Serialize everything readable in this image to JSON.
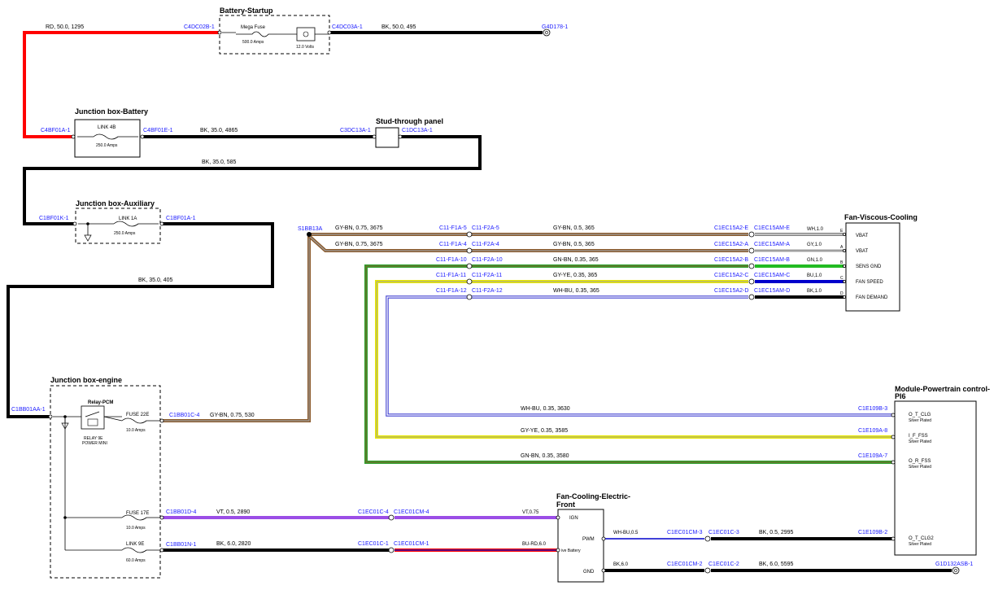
{
  "components": {
    "battery_startup": {
      "title": "Battery-Startup",
      "fuse_label": "Mega Fuse",
      "fuse_rating": "500.0 Amps",
      "battery_voltage": "12.0 Volts"
    },
    "jb_battery": {
      "title": "Junction box-Battery",
      "link": "LINK 4B",
      "rating": "250.0 Amps"
    },
    "stud_panel": {
      "title": "Stud-through panel"
    },
    "jb_aux": {
      "title": "Junction box-Auxiliary",
      "link": "LINK 1A",
      "rating": "250.0 Amps"
    },
    "jb_engine": {
      "title": "Junction box-engine",
      "relay": "Relay-PCM",
      "relay_sub1": "RELAY 9E",
      "relay_sub2": "POWER MINI",
      "fuse22e": "FUSE 22E",
      "fuse22e_rating": "10.0 Amps",
      "fuse17e": "FUSE 17E",
      "fuse17e_rating": "10.0 Amps",
      "link9e": "LINK 9E",
      "link9e_rating": "60.0 Amps"
    },
    "fan_viscous": {
      "title": "Fan-Viscous-Cooling",
      "pins": [
        "VBAT",
        "VBAT",
        "SENS GND",
        "FAN SPEED",
        "FAN DEMAND"
      ]
    },
    "pcm": {
      "title1": "Module-Powertrain control-",
      "title2": "PI6",
      "pins": [
        "O_T_CLG",
        "I_F_FSS",
        "O_R_FSS",
        "O_T_CLG2"
      ],
      "plated": "Silver Plated"
    },
    "fan_front": {
      "title1": "Fan-Cooling-Electric-",
      "title2": "Front",
      "pins": [
        "IGN",
        "PWM",
        "ive Battery",
        "GND"
      ]
    }
  },
  "connectors": {
    "c4dc02b": "C4DC02B-1",
    "c4dc03a": "C4DC03A-1",
    "g4d178": "G4D178-1",
    "c4bf01a": "C4BF01A-1",
    "c4bf01e": "C4BF01E-1",
    "c3dc13a": "C3DC13A-1",
    "c1dc13a": "C1DC13A-1",
    "c1bf01k": "C1BF01K-1",
    "c1bf01a": "C1BF01A-1",
    "c1bb01aa": "C1BB01AA-1",
    "s1bb13a": "S1BB13A",
    "c1bb01c": "C1BB01C-4",
    "c1bb01d": "C1BB01D-4",
    "c1bb01n": "C1BB01N-1",
    "c11f1a5": "C11-F1A-5",
    "c11f2a5": "C11-F2A-5",
    "c11f1a4": "C11-F1A-4",
    "c11f2a4": "C11-F2A-4",
    "c11f1a10": "C11-F1A-10",
    "c11f2a10": "C11-F2A-10",
    "c11f1a11": "C11-F1A-11",
    "c11f2a11": "C11-F2A-11",
    "c11f1a12": "C11-F1A-12",
    "c11f2a12": "C11-F2A-12",
    "c1ec15a2e": "C1EC15A2-E",
    "c1ec15ame": "C1EC15AM-E",
    "c1ec15a2a": "C1EC15A2-A",
    "c1ec15ama": "C1EC15AM-A",
    "c1ec15a2b": "C1EC15A2-B",
    "c1ec15amb": "C1EC15AM-B",
    "c1ec15a2c": "C1EC15A2-C",
    "c1ec15amc": "C1EC15AM-C",
    "c1ec15a2d": "C1EC15A2-D",
    "c1ec15amd": "C1EC15AM-D",
    "c1e109b3": "C1E109B-3",
    "c1e109a8": "C1E109A-8",
    "c1e109a7": "C1E109A-7",
    "c1e109b2": "C1E109B-2",
    "c1ec01c4": "C1EC01C-4",
    "c1ec01cm4": "C1EC01CM-4",
    "c1ec01c1": "C1EC01C-1",
    "c1ec01cm1": "C1EC01CM-1",
    "c1ec01cm3": "C1EC01CM-3",
    "c1ec01c3": "C1EC01C-3",
    "c1ec01cm2": "C1EC01CM-2",
    "c1ec01c2": "C1EC01C-2",
    "g1d132": "G1D132ASB-1"
  },
  "wires": {
    "w_rd": "RD, 50.0, 1295",
    "w_bk495": "BK, 50.0, 495",
    "w_bk4865": "BK, 35.0, 4865",
    "w_bk585": "BK, 35.0, 585",
    "w_bk405": "BK, 35.0, 405",
    "w_gybn530": "GY-BN, 0.75, 530",
    "w_gybn3675a": "GY-BN, 0.75, 3675",
    "w_gybn3675b": "GY-BN, 0.75, 3675",
    "w_gybn365a": "GY-BN, 0.5, 365",
    "w_gybn365b": "GY-BN, 0.5, 365",
    "w_gnbn365": "GN-BN, 0.35, 365",
    "w_gyye365": "GY-YE, 0.35, 365",
    "w_whbu365": "WH-BU, 0.35, 365",
    "w_fv1": "WH,1.0",
    "w_fv2": "GY,1.0",
    "w_fv3": "GN,1.0",
    "w_fv4": "BU,1.0",
    "w_fv5": "BK,1.0",
    "w_whbu3630": "WH-BU, 0.35, 3630",
    "w_gyye3585": "GY-YE, 0.35, 3585",
    "w_gnbn3580": "GN-BN, 0.35, 3580",
    "w_vt2890": "VT, 0.5, 2890",
    "w_vt075": "VT,0.75",
    "w_bk2820": "BK, 6.0, 2820",
    "w_burd": "BU-RD,6.0",
    "w_whbu05": "WH-BU,0.5",
    "w_bk2995": "BK, 0.5, 2995",
    "w_bk60": "BK,6.0",
    "w_bk5595": "BK, 6.0, 5595"
  },
  "pins_letters": [
    "E",
    "A",
    "B",
    "C",
    "D"
  ],
  "colors": {
    "red": "#ff0000",
    "black": "#000000",
    "brown": "#8b5a2b",
    "gray": "#a0a0a0",
    "green": "#2ca02c",
    "yellow": "#e8e800",
    "blue": "#0000cc",
    "violet": "#9b4ee6",
    "connector_text": "#1a1aff"
  }
}
